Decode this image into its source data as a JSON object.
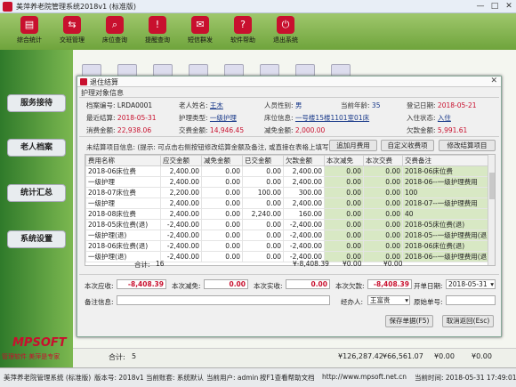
{
  "window": {
    "title": "美萍养老院管理系统2018v1 (标准版)",
    "min": "—",
    "max": "□",
    "close": "✕"
  },
  "toolbar": [
    {
      "label": "综合统计",
      "icon": "chart-icon"
    },
    {
      "label": "交班管理",
      "icon": "handover-icon"
    },
    {
      "label": "床位查询",
      "icon": "bed-search-icon"
    },
    {
      "label": "提醒查询",
      "icon": "reminder-icon"
    },
    {
      "label": "短信群发",
      "icon": "sms-icon"
    },
    {
      "label": "软件帮助",
      "icon": "help-icon"
    },
    {
      "label": "退出系统",
      "icon": "exit-icon"
    }
  ],
  "sidebar": [
    {
      "label": "服务接待"
    },
    {
      "label": "老人档案"
    },
    {
      "label": "统计汇总"
    },
    {
      "label": "系统设置"
    }
  ],
  "brand": {
    "logo": "MPSOFT",
    "slogan": "管理软件  美萍是专家"
  },
  "main_bottom": {
    "count_label": "合计:",
    "count": "5",
    "amt1": "¥126,287.42",
    "amt2": "¥66,561.07",
    "amt3": "¥0.00",
    "amt4": "¥0.00"
  },
  "dialog": {
    "title": "退住结算",
    "close": "✕",
    "section": "护理对象信息",
    "info": {
      "file_no_label": "档案编号:",
      "file_no": "LRDA0001",
      "name_label": "老人姓名:",
      "name": "王木",
      "gender_label": "人员性别:",
      "gender": "男",
      "age_label": "当前年龄:",
      "age": "35",
      "reg_date_label": "登记日期:",
      "reg_date": "2018-05-21",
      "last_settle_label": "最近结算:",
      "last_settle": "2018-05-31",
      "care_type_label": "护理类型:",
      "care_type": "一级护理",
      "bed_label": "床位信息:",
      "bed": "一号楼15楼1101室01床",
      "status_label": "入住状态:",
      "status": "入住",
      "consume_label": "消费金额:",
      "consume": "22,938.06",
      "paid_label": "交费金额:",
      "paid": "14,946.45",
      "reduce_label": "减免金额:",
      "reduce": "2,000.00",
      "owe_label": "欠款金额:",
      "owe": "5,991.61"
    },
    "hint": "未结算项目信息: (提示: 可点击右侧按钮修改结算金额及备注, 或直接在表格上填写)",
    "buttons": {
      "add_fee": "追加月费用",
      "custom_fee": "自定义收费项",
      "modify_item": "修改结算项目",
      "save": "保存单据(F5)",
      "cancel": "取消返回(Esc)"
    },
    "table": {
      "headers": [
        "费用名称",
        "应交金额",
        "减免金额",
        "已交金额",
        "欠款金额",
        "本次减免",
        "本次交费",
        "交费备注"
      ],
      "rows": [
        [
          "2018-06床位费",
          "2,400.00",
          "0.00",
          "0.00",
          "2,400.00",
          "0.00",
          "0.00",
          "2018-06床位费"
        ],
        [
          "一级护理",
          "2,400.00",
          "0.00",
          "0.00",
          "2,400.00",
          "0.00",
          "0.00",
          "2018-06--一级护理费用"
        ],
        [
          "2018-07床位费",
          "2,200.00",
          "0.00",
          "100.00",
          "300.00",
          "0.00",
          "0.00",
          "100"
        ],
        [
          "一级护理",
          "2,400.00",
          "0.00",
          "0.00",
          "2,400.00",
          "0.00",
          "0.00",
          "2018-07--一级护理费用"
        ],
        [
          "2018-08床位费",
          "2,400.00",
          "0.00",
          "2,240.00",
          "160.00",
          "0.00",
          "0.00",
          "40"
        ],
        [
          "2018-05床位费(退)",
          "-2,400.00",
          "0.00",
          "0.00",
          "-2,400.00",
          "0.00",
          "0.00",
          "2018-05床位费(退)"
        ],
        [
          "一级护理(退)",
          "-2,400.00",
          "0.00",
          "0.00",
          "-2,400.00",
          "0.00",
          "0.00",
          "2018-05--一级护理费用(退)"
        ],
        [
          "2018-06床位费(退)",
          "-2,400.00",
          "0.00",
          "0.00",
          "-2,400.00",
          "0.00",
          "0.00",
          "2018-06床位费(退)"
        ],
        [
          "一级护理(退)",
          "-2,400.00",
          "0.00",
          "0.00",
          "-2,400.00",
          "0.00",
          "0.00",
          "2018-06--一级护理费用(退)"
        ]
      ],
      "sum_label": "合计:",
      "sum_count": "16",
      "sum_owe": "¥-8,408.39",
      "sum_reduce": "¥0.00",
      "sum_pay": "¥0.00"
    },
    "footer": {
      "should_label": "本次应收:",
      "should": "-8,408.39",
      "reduce_label": "本次减免:",
      "reduce": "0.00",
      "actual_label": "本次实收:",
      "actual": "0.00",
      "owe_label": "本次欠款:",
      "owe": "-8,408.39",
      "date_label": "开单日期:",
      "date": "2018-05-31",
      "remark_label": "备注信息:",
      "remark": "",
      "handler_label": "经办人:",
      "handler": "王富贵",
      "orig_label": "原始单号:",
      "orig": ""
    }
  },
  "status": {
    "app": "美萍养老院管理系统  (标准版)",
    "version": "版本号: 2018v1",
    "account": "当前账套: 系统默认",
    "user": "当前用户: admin",
    "help": "按F1查看帮助文档",
    "web": "http://www.mpsoft.net.cn",
    "time": "当前时间: 2018-05-31 17:49:01"
  }
}
